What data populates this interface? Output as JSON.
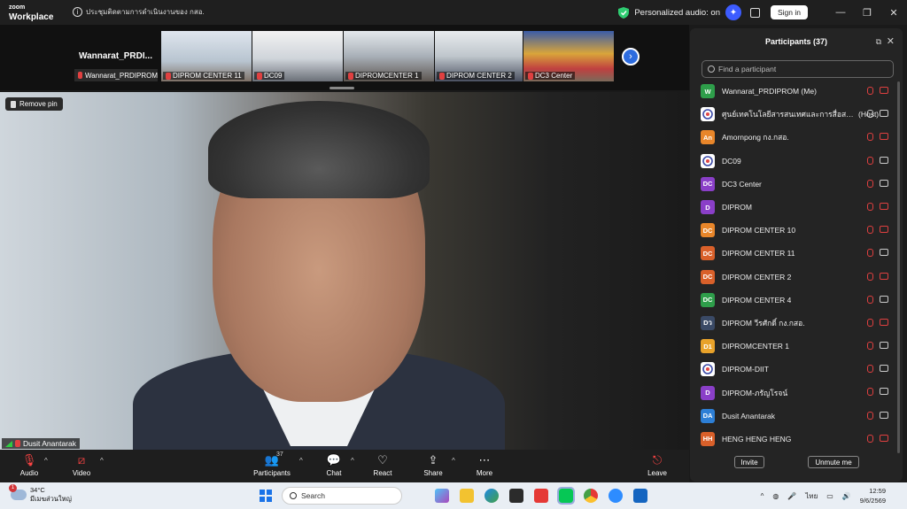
{
  "titlebar": {
    "brand_line1": "zoom",
    "brand_line2": "Workplace",
    "meeting_info": "ประชุมติดตามการดำเนินงานของ กสอ.",
    "personalized_audio": "Personalized audio: on",
    "sign_in": "Sign in",
    "minimize": "—",
    "restore": "❐",
    "close": "✕"
  },
  "strip": {
    "self_name": "Wannarat_PRDI...",
    "self_label": "Wannarat_PRDIPROM",
    "thumbs": [
      {
        "label": "DIPROM CENTER 11"
      },
      {
        "label": "DC09"
      },
      {
        "label": "DIPROMCENTER 1"
      },
      {
        "label": "DIPROM CENTER 2"
      },
      {
        "label": "DC3 Center"
      }
    ],
    "next": "›"
  },
  "video": {
    "remove_pin": "Remove pin",
    "speaker": "Dusit Anantarak"
  },
  "toolbar": {
    "audio": "Audio",
    "video": "Video",
    "participants": "Participants",
    "participants_count": "37",
    "chat": "Chat",
    "react": "React",
    "share": "Share",
    "more": "More",
    "leave": "Leave"
  },
  "panel": {
    "title": "Participants (37)",
    "search_placeholder": "Find a participant",
    "invite": "Invite",
    "unmute_me": "Unmute me",
    "participants": [
      {
        "initials": "W",
        "color": "#2e9e4a",
        "name": "Wannarat_PRDIPROM (Me)",
        "mic_on": false,
        "cam_on": false
      },
      {
        "initials": "",
        "color": "#ffffff",
        "name": "ศูนย์เทคโนโลยีสารสนเทศและการสื่อสาร ...",
        "host": "(Host)",
        "mic_on": true,
        "cam_on": true
      },
      {
        "initials": "An",
        "color": "#e8862a",
        "name": "Amornpong กง.กสอ.",
        "mic_on": false,
        "cam_on": false
      },
      {
        "initials": "",
        "color": "#ffffff",
        "name": "DC09",
        "mic_on": false,
        "cam_on": true
      },
      {
        "initials": "DC",
        "color": "#8a3fc8",
        "name": "DC3 Center",
        "mic_on": false,
        "cam_on": true
      },
      {
        "initials": "D",
        "color": "#8a3fc8",
        "name": "DIPROM",
        "mic_on": false,
        "cam_on": false
      },
      {
        "initials": "DC",
        "color": "#e8862a",
        "name": "DIPROM CENTER 10",
        "mic_on": false,
        "cam_on": false
      },
      {
        "initials": "DC",
        "color": "#d9602a",
        "name": "DIPROM CENTER 11",
        "mic_on": false,
        "cam_on": true
      },
      {
        "initials": "DC",
        "color": "#d9602a",
        "name": "DIPROM CENTER 2",
        "mic_on": false,
        "cam_on": false
      },
      {
        "initials": "DC",
        "color": "#2e9e4a",
        "name": "DIPROM CENTER 4",
        "mic_on": false,
        "cam_on": true
      },
      {
        "initials": "Dว",
        "color": "#3a4a66",
        "name": "DIPROM วีรศักดิ์ กง.กสอ.",
        "mic_on": false,
        "cam_on": false
      },
      {
        "initials": "D1",
        "color": "#e8a22a",
        "name": "DIPROMCENTER 1",
        "mic_on": false,
        "cam_on": true
      },
      {
        "initials": "",
        "color": "#ffffff",
        "name": "DIPROM-DIIT",
        "mic_on": false,
        "cam_on": true
      },
      {
        "initials": "D",
        "color": "#8a3fc8",
        "name": "DIPROM-ภรัญโรจน์",
        "mic_on": false,
        "cam_on": true
      },
      {
        "initials": "DA",
        "color": "#2d7fd6",
        "name": "Dusit Anantarak",
        "mic_on": false,
        "cam_on": true
      },
      {
        "initials": "HH",
        "color": "#d9602a",
        "name": "HENG HENG HENG",
        "mic_on": false,
        "cam_on": false
      }
    ]
  },
  "taskbar": {
    "weather_temp": "34°C",
    "weather_desc": "มีเมฆส่วนใหญ่",
    "weather_badge": "1",
    "search": "Search",
    "lang": "ไทย",
    "time": "12:59",
    "date": "9/6/2569"
  }
}
